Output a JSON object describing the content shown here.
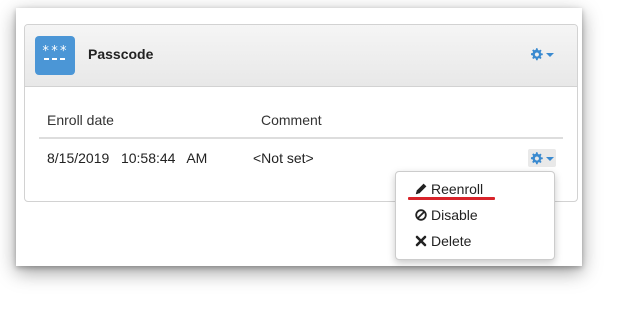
{
  "panel": {
    "title": "Passcode",
    "icon": "passcode-icon",
    "icon_dots": "***",
    "accent_color": "#4b96d6"
  },
  "table": {
    "columns": [
      "Enroll date",
      "Comment"
    ],
    "rows": [
      {
        "enroll_date": "8/15/2019   10:58:44   AM",
        "comment": "<Not set>"
      }
    ]
  },
  "dropdown_menu": {
    "items": [
      {
        "label": "Reenroll",
        "icon": "pencil-icon"
      },
      {
        "label": "Disable",
        "icon": "ban-icon"
      },
      {
        "label": "Delete",
        "icon": "times-icon"
      }
    ]
  },
  "highlight_color": "#d8232a",
  "gear_color": "#3a8ad0"
}
